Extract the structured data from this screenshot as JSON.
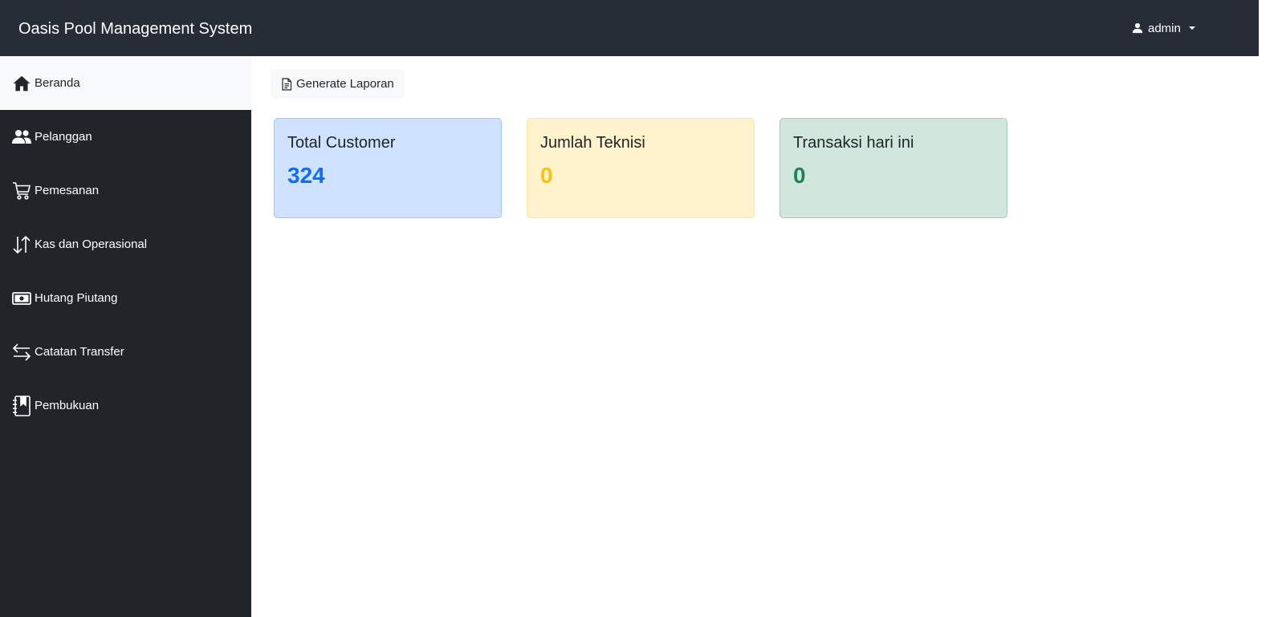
{
  "header": {
    "brand": "Oasis Pool Management System",
    "user_label": "admin"
  },
  "sidebar": {
    "items": [
      {
        "label": "Beranda",
        "icon": "house-icon",
        "active": true
      },
      {
        "label": "Pelanggan",
        "icon": "people-icon"
      },
      {
        "label": "Pemesanan",
        "icon": "cart-icon"
      },
      {
        "label": "Kas dan Operasional",
        "icon": "arrow-down-up-icon"
      },
      {
        "label": "Hutang Piutang",
        "icon": "cash-icon"
      },
      {
        "label": "Catatan Transfer",
        "icon": "arrow-left-right-icon"
      },
      {
        "label": "Pembukuan",
        "icon": "journal-bookmark-icon"
      }
    ]
  },
  "main": {
    "generate_button": "Generate Laporan",
    "cards": [
      {
        "title": "Total Customer",
        "value": "324",
        "color": "#0d6efd"
      },
      {
        "title": "Jumlah Teknisi",
        "value": "0",
        "color": "#ffc107"
      },
      {
        "title": "Transaksi hari ini",
        "value": "0",
        "color": "#198754"
      }
    ]
  },
  "colors": {
    "topbar": "#272d36",
    "sidebar": "#212529",
    "active_item_bg": "#f8f9fa"
  }
}
